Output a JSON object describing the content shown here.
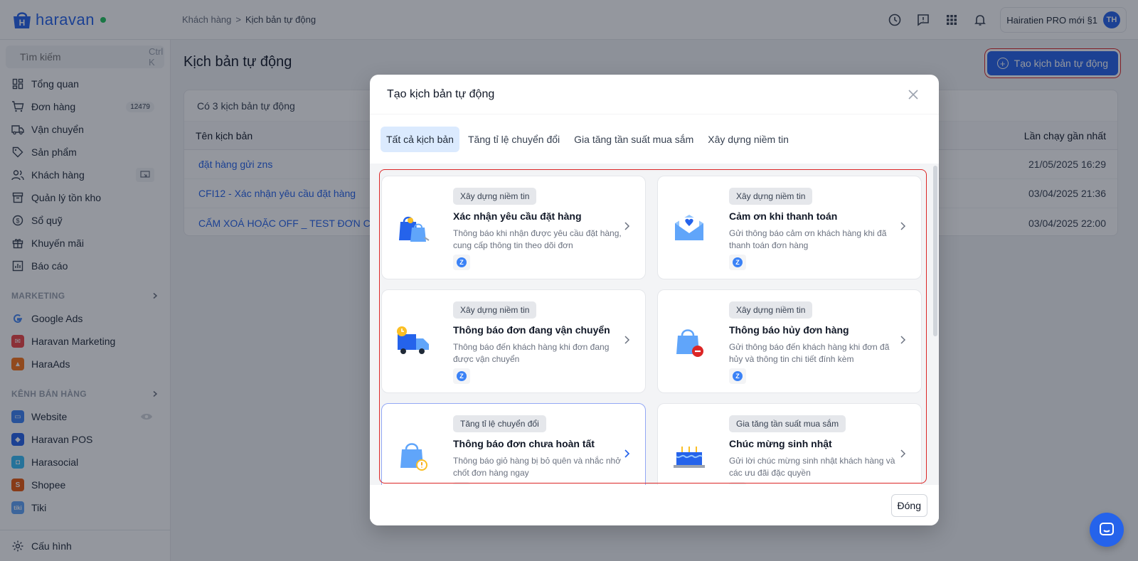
{
  "app": {
    "logo_text": "haravan"
  },
  "breadcrumb": {
    "parent": "Khách hàng",
    "separator": ">",
    "current": "Kịch bản tự động"
  },
  "header": {
    "user_name": "Hairatien PRO mới §1",
    "avatar_initials": "TH"
  },
  "sidebar": {
    "search_placeholder": "Tìm kiếm",
    "search_shortcut": "Ctrl K",
    "items": [
      {
        "label": "Tổng quan",
        "icon": "dashboard-icon"
      },
      {
        "label": "Đơn hàng",
        "icon": "cart-icon",
        "badge": "12479"
      },
      {
        "label": "Vận chuyển",
        "icon": "truck-icon"
      },
      {
        "label": "Sản phẩm",
        "icon": "tag-icon"
      },
      {
        "label": "Khách hàng",
        "icon": "users-icon"
      },
      {
        "label": "Quản lý tồn kho",
        "icon": "inventory-icon"
      },
      {
        "label": "Sổ quỹ",
        "icon": "dollar-icon"
      },
      {
        "label": "Khuyến mãi",
        "icon": "gift-icon"
      },
      {
        "label": "Báo cáo",
        "icon": "report-icon"
      }
    ],
    "marketing_title": "MARKETING",
    "marketing": [
      {
        "label": "Google Ads",
        "color": "#ffffff"
      },
      {
        "label": "Haravan Marketing",
        "color": "#ef4444"
      },
      {
        "label": "HaraAds",
        "color": "#f97316"
      }
    ],
    "sales_title": "KÊNH BÁN HÀNG",
    "channels": [
      {
        "label": "Website",
        "color": "#3b82f6"
      },
      {
        "label": "Haravan POS",
        "color": "#2563eb"
      },
      {
        "label": "Harasocial",
        "color": "#38bdf8"
      },
      {
        "label": "Shopee",
        "color": "#ea580c"
      },
      {
        "label": "Tiki",
        "color": "#60a5fa",
        "glyph": "tiki"
      }
    ],
    "settings_label": "Cấu hình"
  },
  "page": {
    "title": "Kịch bản tự động",
    "create_button": "Tạo kịch bản tự động",
    "count_text": "Có 3 kịch bản tự động",
    "col_name": "Tên kịch bản",
    "col_last_run": "Lần chạy gần nhất",
    "rows": [
      {
        "name": "đặt hàng gửi zns",
        "last_run": "21/05/2025 16:29"
      },
      {
        "name": "CFI12 - Xác nhận yêu cầu đặt hàng",
        "last_run": "03/04/2025 21:36"
      },
      {
        "name": "CẤM XOÁ HOẶC OFF _ TEST ĐƠN CHƯ",
        "last_run": "03/04/2025 22:00"
      }
    ]
  },
  "modal": {
    "title": "Tạo kịch bản tự động",
    "tabs": [
      "Tất cả kịch bản",
      "Tăng tỉ lệ chuyển đổi",
      "Gia tăng tần suất mua sắm",
      "Xây dựng niềm tin"
    ],
    "active_tab": 0,
    "cards": [
      {
        "tag": "Xây dựng niềm tin",
        "title": "Xác nhận yêu cầu đặt hàng",
        "desc": "Thông báo khi nhận được yêu cầu đặt hàng, cung cấp thông tin theo dõi đơn",
        "icon": "shopping-bag-check-icon",
        "channel": "zalo-icon"
      },
      {
        "tag": "Xây dựng niềm tin",
        "title": "Cảm ơn khi thanh toán",
        "desc": "Gửi thông báo cảm ơn khách hàng khi đã thanh toán đơn hàng",
        "icon": "envelope-heart-icon",
        "channel": "zalo-icon"
      },
      {
        "tag": "Xây dựng niềm tin",
        "title": "Thông báo đơn đang vận chuyển",
        "desc": "Thông báo đến khách hàng khi đơn đang được vận chuyển",
        "icon": "delivery-truck-icon",
        "channel": "zalo-icon"
      },
      {
        "tag": "Xây dựng niềm tin",
        "title": "Thông báo hủy đơn hàng",
        "desc": "Gửi thông báo đến khách hàng khi đơn đã hủy và thông tin chi tiết đính kèm",
        "icon": "bag-cancel-icon",
        "channel": "zalo-icon"
      },
      {
        "tag": "Tăng tỉ lệ chuyển đổi",
        "title": "Thông báo đơn chưa hoàn tất",
        "desc": "Thông báo giỏ hàng bị bỏ quên và nhắc nhở chốt đơn hàng ngay",
        "icon": "bag-warning-icon",
        "channel": "zalo-icon"
      },
      {
        "tag": "Gia tăng tần suất mua sắm",
        "title": "Chúc mừng sinh nhật",
        "desc": "Gửi lời chúc mừng sinh nhật khách hàng và các ưu đãi đặc quyền",
        "icon": "birthday-cake-icon",
        "channel": "zalo-icon"
      }
    ],
    "close_button": "Đóng"
  },
  "colors": {
    "accent": "#2563eb",
    "highlight": "#dc2626"
  }
}
